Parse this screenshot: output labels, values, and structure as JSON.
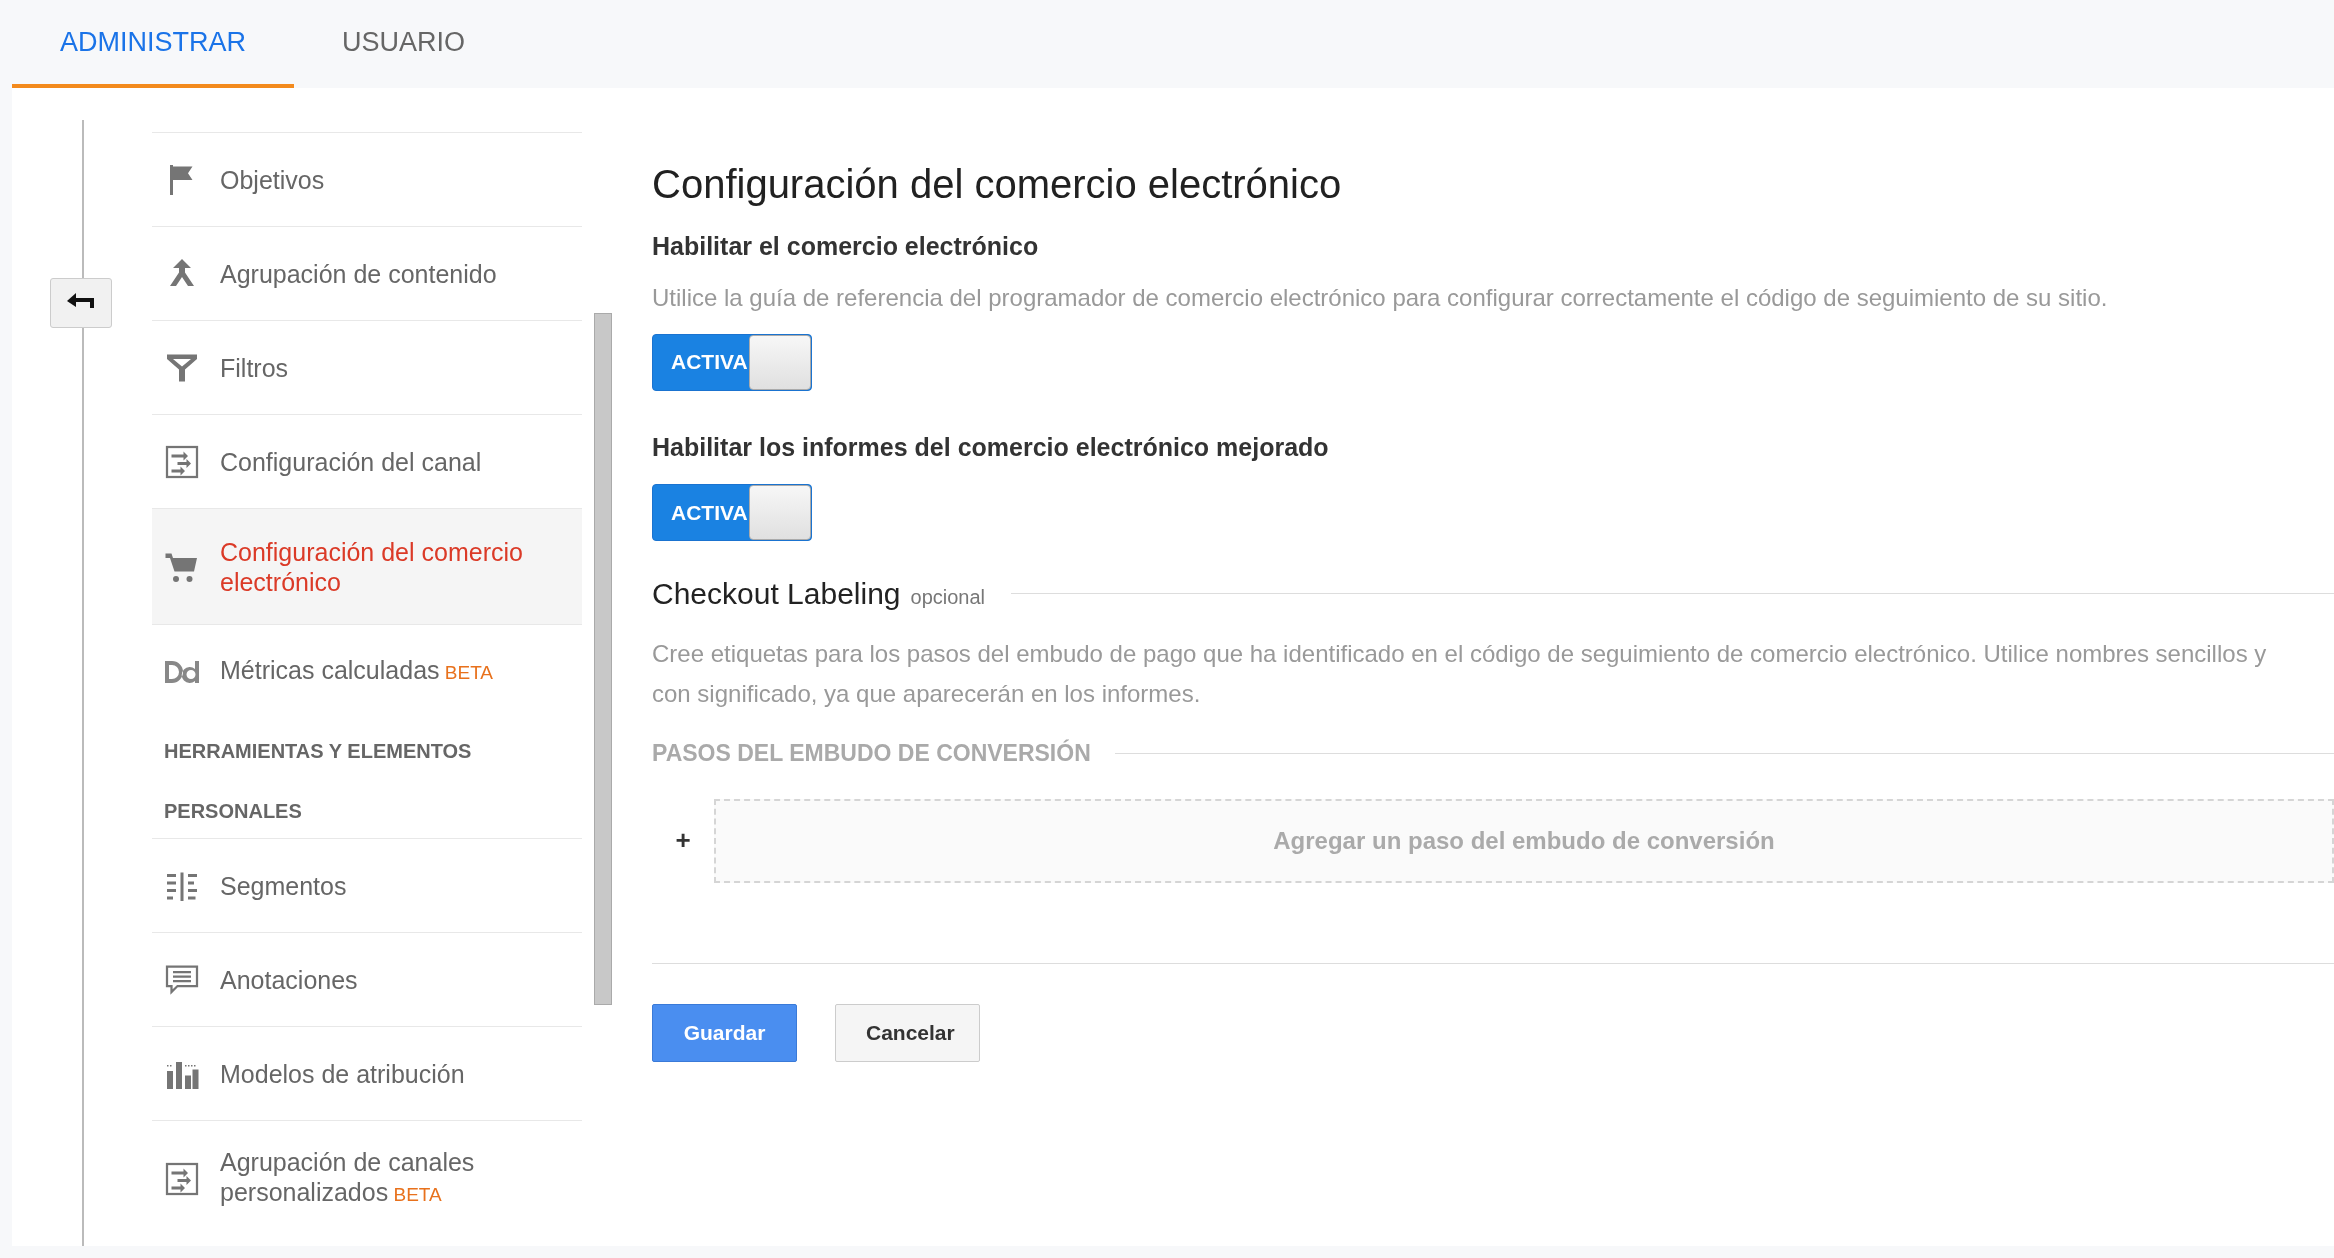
{
  "tabs": [
    {
      "label": "ADMINISTRAR",
      "selected": true
    },
    {
      "label": "USUARIO",
      "selected": false
    }
  ],
  "sidebar": {
    "items": [
      {
        "kind": "item",
        "label": "Objetivos",
        "selected": false
      },
      {
        "kind": "item",
        "label": "Agrupación de contenido",
        "selected": false
      },
      {
        "kind": "item",
        "label": "Filtros",
        "selected": false
      },
      {
        "kind": "item",
        "label": "Configuración del canal",
        "selected": false
      },
      {
        "kind": "item",
        "label": "Configuración del comercio electrónico",
        "selected": true
      },
      {
        "kind": "item",
        "label": "Métricas calculadas",
        "badge": "BETA",
        "selected": false
      },
      {
        "kind": "section",
        "label": "HERRAMIENTAS Y ELEMENTOS"
      },
      {
        "kind": "section",
        "label": "PERSONALES"
      },
      {
        "kind": "item",
        "label": "Segmentos",
        "selected": false
      },
      {
        "kind": "item",
        "label": "Anotaciones",
        "selected": false
      },
      {
        "kind": "item",
        "label": "Modelos de atribución",
        "selected": false
      },
      {
        "kind": "item",
        "label": "Agrupación de canales personalizados",
        "badge": "BETA",
        "selected": false
      }
    ]
  },
  "main": {
    "title": "Configuración del comercio electrónico",
    "settings": [
      {
        "heading": "Habilitar el comercio electrónico",
        "description": "Utilice la guía de referencia del programador de comercio electrónico para configurar correctamente el código de seguimiento de su sitio.",
        "toggle_label": "ACTIVA",
        "on": true
      },
      {
        "heading": "Habilitar los informes del comercio electrónico mejorado",
        "toggle_label": "ACTIVA",
        "on": true
      }
    ],
    "checkout": {
      "title": "Checkout Labeling",
      "optional": "opcional",
      "description": "Cree etiquetas para los pasos del embudo de pago que ha identificado en el código de seguimiento de comercio electrónico. Utilice nombres sencillos y con significado, ya que aparecerán en los informes.",
      "steps_heading": "PASOS DEL EMBUDO DE CONVERSIÓN",
      "add_icon": "+",
      "add_placeholder": "Agregar un paso del embudo de conversión"
    },
    "buttons": [
      {
        "label": "Guardar",
        "kind": "primary"
      },
      {
        "label": "Cancelar",
        "kind": "secondary"
      }
    ]
  }
}
